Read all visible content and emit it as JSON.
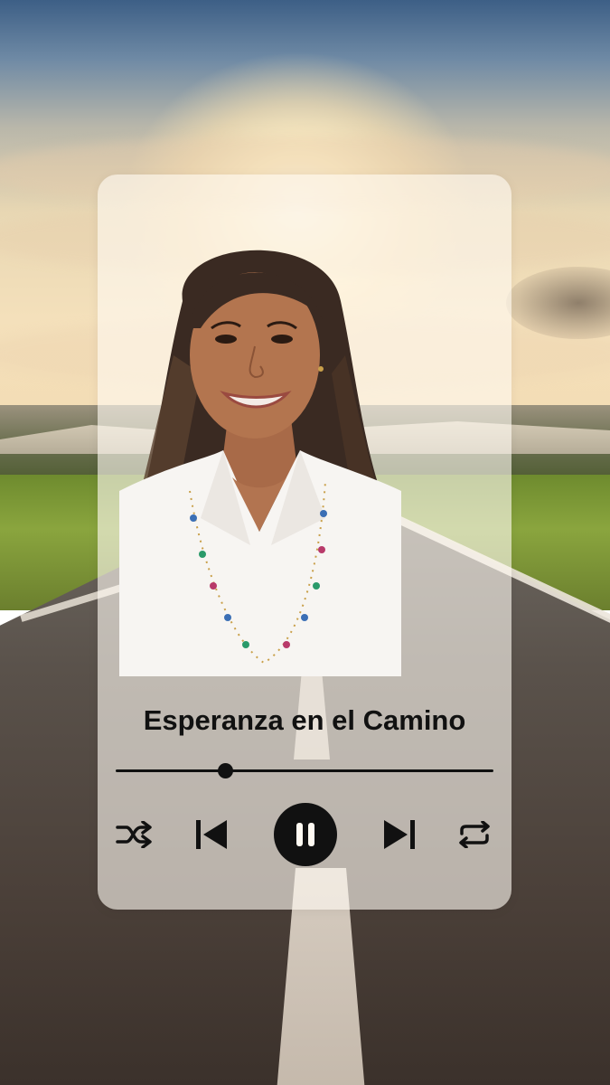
{
  "player": {
    "track_title": "Esperanza en el Camino",
    "progress_fraction": 0.29,
    "state": "playing"
  },
  "controls": {
    "shuffle_icon": "shuffle-icon",
    "previous_icon": "skip-previous-icon",
    "play_pause_icon": "pause-icon",
    "next_icon": "skip-next-icon",
    "repeat_icon": "repeat-icon"
  },
  "colors": {
    "controls": "#111111",
    "card_background": "#fffaf2"
  }
}
